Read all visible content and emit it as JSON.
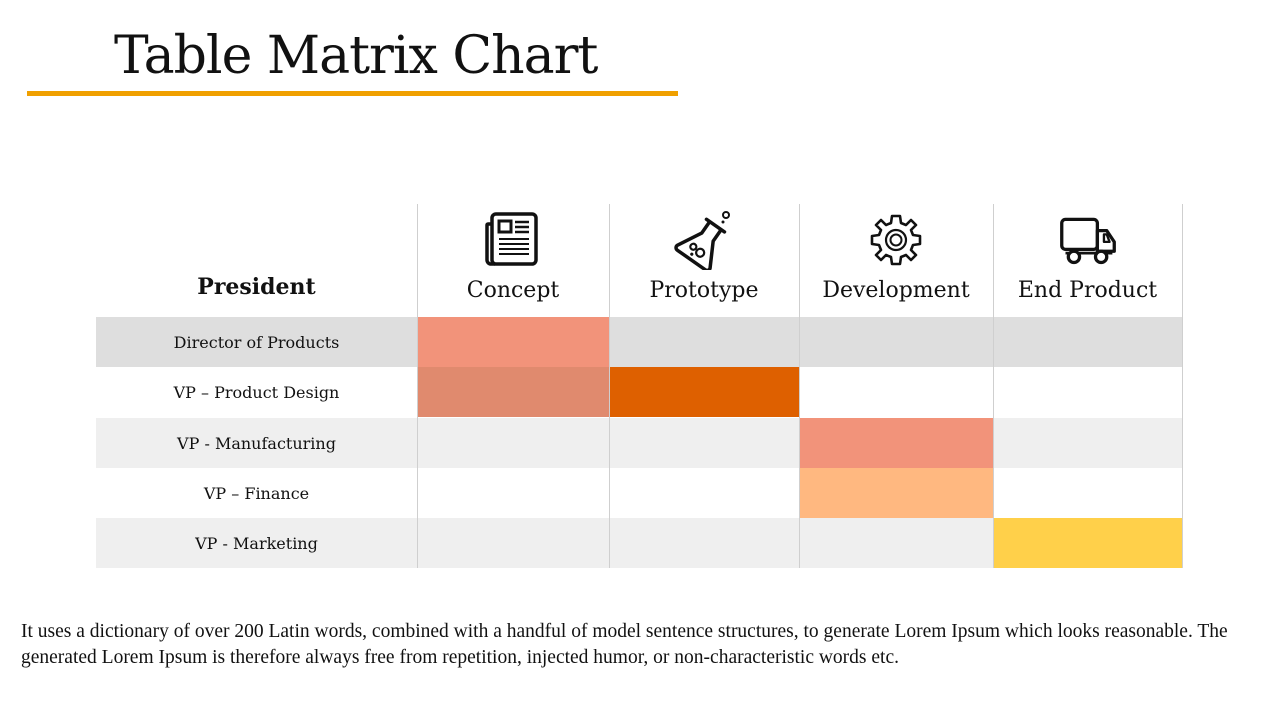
{
  "header": {
    "title": "Table Matrix Chart",
    "accent_color": "#f0a000"
  },
  "matrix": {
    "corner_label": "President",
    "columns": [
      {
        "label": "Concept",
        "icon": "newspaper-icon"
      },
      {
        "label": "Prototype",
        "icon": "flask-icon"
      },
      {
        "label": "Development",
        "icon": "gear-icon"
      },
      {
        "label": "End Product",
        "icon": "truck-icon"
      }
    ],
    "rows": [
      {
        "label": "Director of Products",
        "highlights": [
          {
            "column": 0,
            "color": "#f2937a"
          }
        ]
      },
      {
        "label": "VP – Product Design",
        "highlights": [
          {
            "column": 0,
            "color": "#e08a6e"
          },
          {
            "column": 1,
            "color": "#de6000"
          }
        ]
      },
      {
        "label": "VP - Manufacturing",
        "highlights": [
          {
            "column": 2,
            "color": "#f2937a"
          }
        ]
      },
      {
        "label": "VP – Finance",
        "highlights": [
          {
            "column": 2,
            "color": "#ffb880"
          }
        ]
      },
      {
        "label": "VP - Marketing",
        "highlights": [
          {
            "column": 3,
            "color": "#ffd04a"
          }
        ]
      }
    ]
  },
  "footer": {
    "text": "It uses a dictionary of over 200 Latin words, combined with a handful of model sentence structures, to generate Lorem Ipsum which looks reasonable. The generated Lorem Ipsum is therefore always free from repetition, injected humor, or non-characteristic words etc."
  }
}
